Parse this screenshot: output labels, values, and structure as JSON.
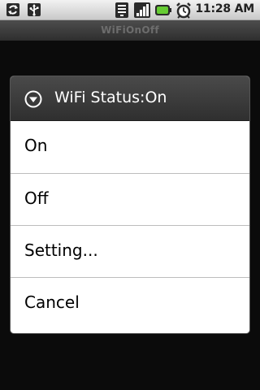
{
  "status_bar": {
    "time": "11:28 AM",
    "icons_left": [
      "sync-icon",
      "usb-icon"
    ],
    "icons_right": [
      "wifi-icon",
      "signal-icon",
      "battery-icon",
      "alarm-icon"
    ],
    "battery_color": "#66cc33"
  },
  "app": {
    "title": "WiFiOnOff"
  },
  "dialog": {
    "title": "WiFi Status:On",
    "icon": "chevron-down-circle-icon",
    "items": [
      {
        "label": "On"
      },
      {
        "label": "Off"
      },
      {
        "label": "Setting..."
      },
      {
        "label": "Cancel"
      }
    ]
  }
}
